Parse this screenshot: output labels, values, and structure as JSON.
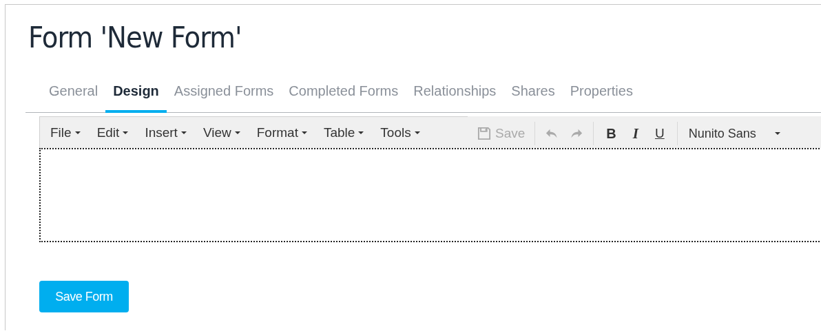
{
  "title": "Form 'New Form'",
  "tabs": [
    {
      "label": "General",
      "selected": false
    },
    {
      "label": "Design",
      "selected": true
    },
    {
      "label": "Assigned Forms",
      "selected": false
    },
    {
      "label": "Completed Forms",
      "selected": false
    },
    {
      "label": "Relationships",
      "selected": false
    },
    {
      "label": "Shares",
      "selected": false
    },
    {
      "label": "Properties",
      "selected": false
    }
  ],
  "editor": {
    "menus": [
      {
        "label": "File"
      },
      {
        "label": "Edit"
      },
      {
        "label": "Insert"
      },
      {
        "label": "View"
      },
      {
        "label": "Format"
      },
      {
        "label": "Table"
      },
      {
        "label": "Tools"
      }
    ],
    "toolbar_groups": [
      [
        {
          "kind": "save",
          "label": "Save",
          "disabled": true
        }
      ],
      [
        {
          "kind": "undo",
          "disabled": true
        },
        {
          "kind": "redo",
          "disabled": true
        }
      ],
      [
        {
          "kind": "bold",
          "label": "B",
          "disabled": false
        },
        {
          "kind": "italic",
          "label": "I",
          "disabled": false
        },
        {
          "kind": "underline",
          "label": "U",
          "disabled": false
        }
      ]
    ],
    "font_select": {
      "value": "Nunito Sans"
    }
  },
  "save_button": {
    "label": "Save Form"
  }
}
